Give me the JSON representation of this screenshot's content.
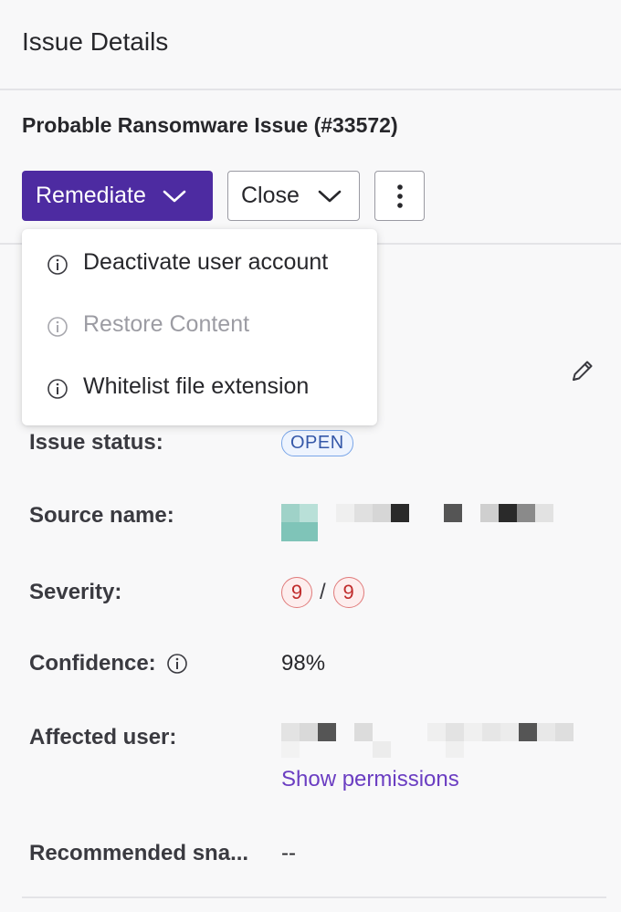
{
  "header": {
    "title": "Issue Details"
  },
  "issue": {
    "title": "Probable Ransomware Issue (#33572)"
  },
  "actions": {
    "remediate_label": "Remediate",
    "close_label": "Close",
    "more_icon": "kebab-vertical-icon",
    "chevron_icon": "chevron-down-icon"
  },
  "remediate_menu": {
    "items": [
      {
        "label": "Deactivate user account",
        "icon": "info-icon",
        "disabled": false
      },
      {
        "label": "Restore Content",
        "icon": "info-icon",
        "disabled": true
      },
      {
        "label": "Whitelist file extension",
        "icon": "info-icon",
        "disabled": false
      }
    ]
  },
  "details": {
    "issue_status": {
      "label": "Issue status:",
      "value": "OPEN"
    },
    "source_name": {
      "label": "Source name:"
    },
    "severity": {
      "label": "Severity:",
      "value": "9",
      "max": "9",
      "separator": "/"
    },
    "confidence": {
      "label": "Confidence:",
      "value": "98%",
      "info_icon": "info-icon"
    },
    "affected_user": {
      "label": "Affected user:",
      "link": "Show permissions"
    },
    "recommended_snapshot": {
      "label": "Recommended sna...",
      "value": "--"
    }
  },
  "colors": {
    "primary": "#4d2ba1",
    "link": "#6b3ec2",
    "open_badge": "#3558a8",
    "severity": "#c02c2c"
  }
}
